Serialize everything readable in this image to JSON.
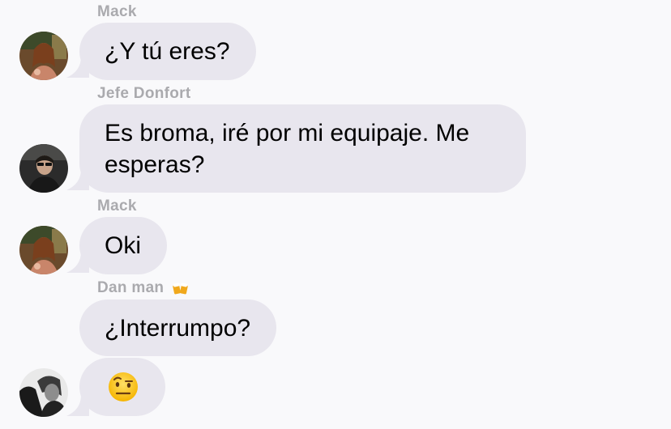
{
  "messages": [
    {
      "sender": "Mack",
      "text": "¿Y tú eres?"
    },
    {
      "sender": "Jefe Donfort",
      "text": "Es broma, iré por mi equipaje. Me esperas?"
    },
    {
      "sender": "Mack",
      "text": "Oki"
    },
    {
      "sender": "Dan man",
      "text": "¿Interrumpo?"
    },
    {
      "sender": "",
      "emoji": "raised-eyebrow-face-icon"
    }
  ],
  "avatars": [
    "mack-avatar",
    "jefe-donfort-avatar",
    "mack-avatar",
    "dan-man-avatar"
  ],
  "sender_badge": "beer-mugs-icon",
  "colors": {
    "background": "#f9f9fb",
    "bubble": "#e8e6ee",
    "sender_name": "#aaaaae"
  }
}
